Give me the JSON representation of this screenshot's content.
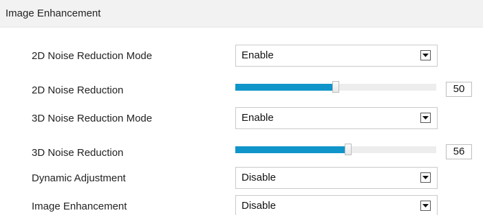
{
  "header": {
    "title": "Image Enhancement"
  },
  "settings": [
    {
      "kind": "select",
      "label": "2D Noise Reduction Mode",
      "value": "Enable"
    },
    {
      "kind": "slider",
      "label": "2D Noise Reduction",
      "value": "50",
      "level": 0.5
    },
    {
      "kind": "select",
      "label": "3D Noise Reduction Mode",
      "value": "Enable"
    },
    {
      "kind": "slider",
      "label": "3D Noise Reduction",
      "value": "56",
      "level": 0.56
    },
    {
      "kind": "select",
      "label": "Dynamic Adjustment",
      "value": "Disable"
    },
    {
      "kind": "select",
      "label": "Image Enhancement",
      "value": "Disable"
    }
  ],
  "icons": {
    "dropdown": "chevron-down-icon"
  },
  "colors": {
    "slider_fill": "#0f95c9",
    "slider_track": "#ededed",
    "header_bg": "#f2f2f2"
  }
}
